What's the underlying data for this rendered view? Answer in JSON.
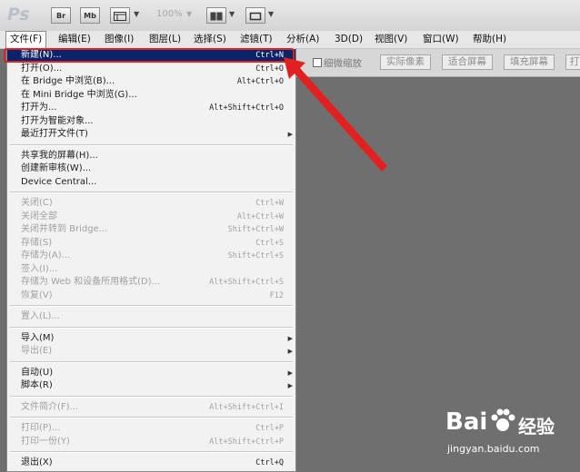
{
  "toolbar": {
    "logo": "Ps",
    "bridge_label": "Br",
    "minibridge_label": "Mb",
    "zoom": "100%"
  },
  "menubar": [
    {
      "label": "文件(F)",
      "active": true
    },
    {
      "label": "编辑(E)"
    },
    {
      "label": "图像(I)"
    },
    {
      "label": "图层(L)"
    },
    {
      "label": "选择(S)"
    },
    {
      "label": "滤镜(T)"
    },
    {
      "label": "分析(A)"
    },
    {
      "label": "3D(D)"
    },
    {
      "label": "视图(V)"
    },
    {
      "label": "窗口(W)"
    },
    {
      "label": "帮助(H)"
    }
  ],
  "options_bar": {
    "scrubby_zoom_label": "细微缩放",
    "actual_pixels": "实际像素",
    "fit_screen": "适合屏幕",
    "fill_screen": "填充屏幕",
    "print_size_partial": "打"
  },
  "file_menu": {
    "items": [
      {
        "label": "新建(N)...",
        "shortcut": "Ctrl+N",
        "highlighted": true
      },
      {
        "label": "打开(O)...",
        "shortcut": "Ctrl+O"
      },
      {
        "label": "在 Bridge 中浏览(B)...",
        "shortcut": "Alt+Ctrl+O"
      },
      {
        "label": "在 Mini Bridge 中浏览(G)..."
      },
      {
        "label": "打开为...",
        "shortcut": "Alt+Shift+Ctrl+O"
      },
      {
        "label": "打开为智能对象..."
      },
      {
        "label": "最近打开文件(T)",
        "submenu": true
      },
      {
        "separator": true
      },
      {
        "label": "共享我的屏幕(H)..."
      },
      {
        "label": "创建新审核(W)..."
      },
      {
        "label": "Device Central..."
      },
      {
        "separator": true
      },
      {
        "label": "关闭(C)",
        "shortcut": "Ctrl+W",
        "disabled": true
      },
      {
        "label": "关闭全部",
        "shortcut": "Alt+Ctrl+W",
        "disabled": true
      },
      {
        "label": "关闭并转到 Bridge...",
        "shortcut": "Shift+Ctrl+W",
        "disabled": true
      },
      {
        "label": "存储(S)",
        "shortcut": "Ctrl+S",
        "disabled": true
      },
      {
        "label": "存储为(A)...",
        "shortcut": "Shift+Ctrl+S",
        "disabled": true
      },
      {
        "label": "签入(I)...",
        "disabled": true
      },
      {
        "label": "存储为 Web 和设备所用格式(D)...",
        "shortcut": "Alt+Shift+Ctrl+S",
        "disabled": true
      },
      {
        "label": "恢复(V)",
        "shortcut": "F12",
        "disabled": true
      },
      {
        "separator": true
      },
      {
        "label": "置入(L)...",
        "disabled": true
      },
      {
        "separator": true
      },
      {
        "label": "导入(M)",
        "submenu": true
      },
      {
        "label": "导出(E)",
        "submenu": true,
        "disabled": true
      },
      {
        "separator": true
      },
      {
        "label": "自动(U)",
        "submenu": true
      },
      {
        "label": "脚本(R)",
        "submenu": true
      },
      {
        "separator": true
      },
      {
        "label": "文件简介(F)...",
        "shortcut": "Alt+Shift+Ctrl+I",
        "disabled": true
      },
      {
        "separator": true
      },
      {
        "label": "打印(P)...",
        "shortcut": "Ctrl+P",
        "disabled": true
      },
      {
        "label": "打印一份(Y)",
        "shortcut": "Alt+Shift+Ctrl+P",
        "disabled": true
      },
      {
        "separator": true
      },
      {
        "label": "退出(X)",
        "shortcut": "Ctrl+Q"
      }
    ]
  },
  "watermark": {
    "brand_left": "Bai",
    "brand_right": "经验",
    "url": "jingyan.baidu.com"
  },
  "colors": {
    "highlight": "#0a246a",
    "annotation_red": "#e32020",
    "workspace": "#6f6f6f"
  }
}
